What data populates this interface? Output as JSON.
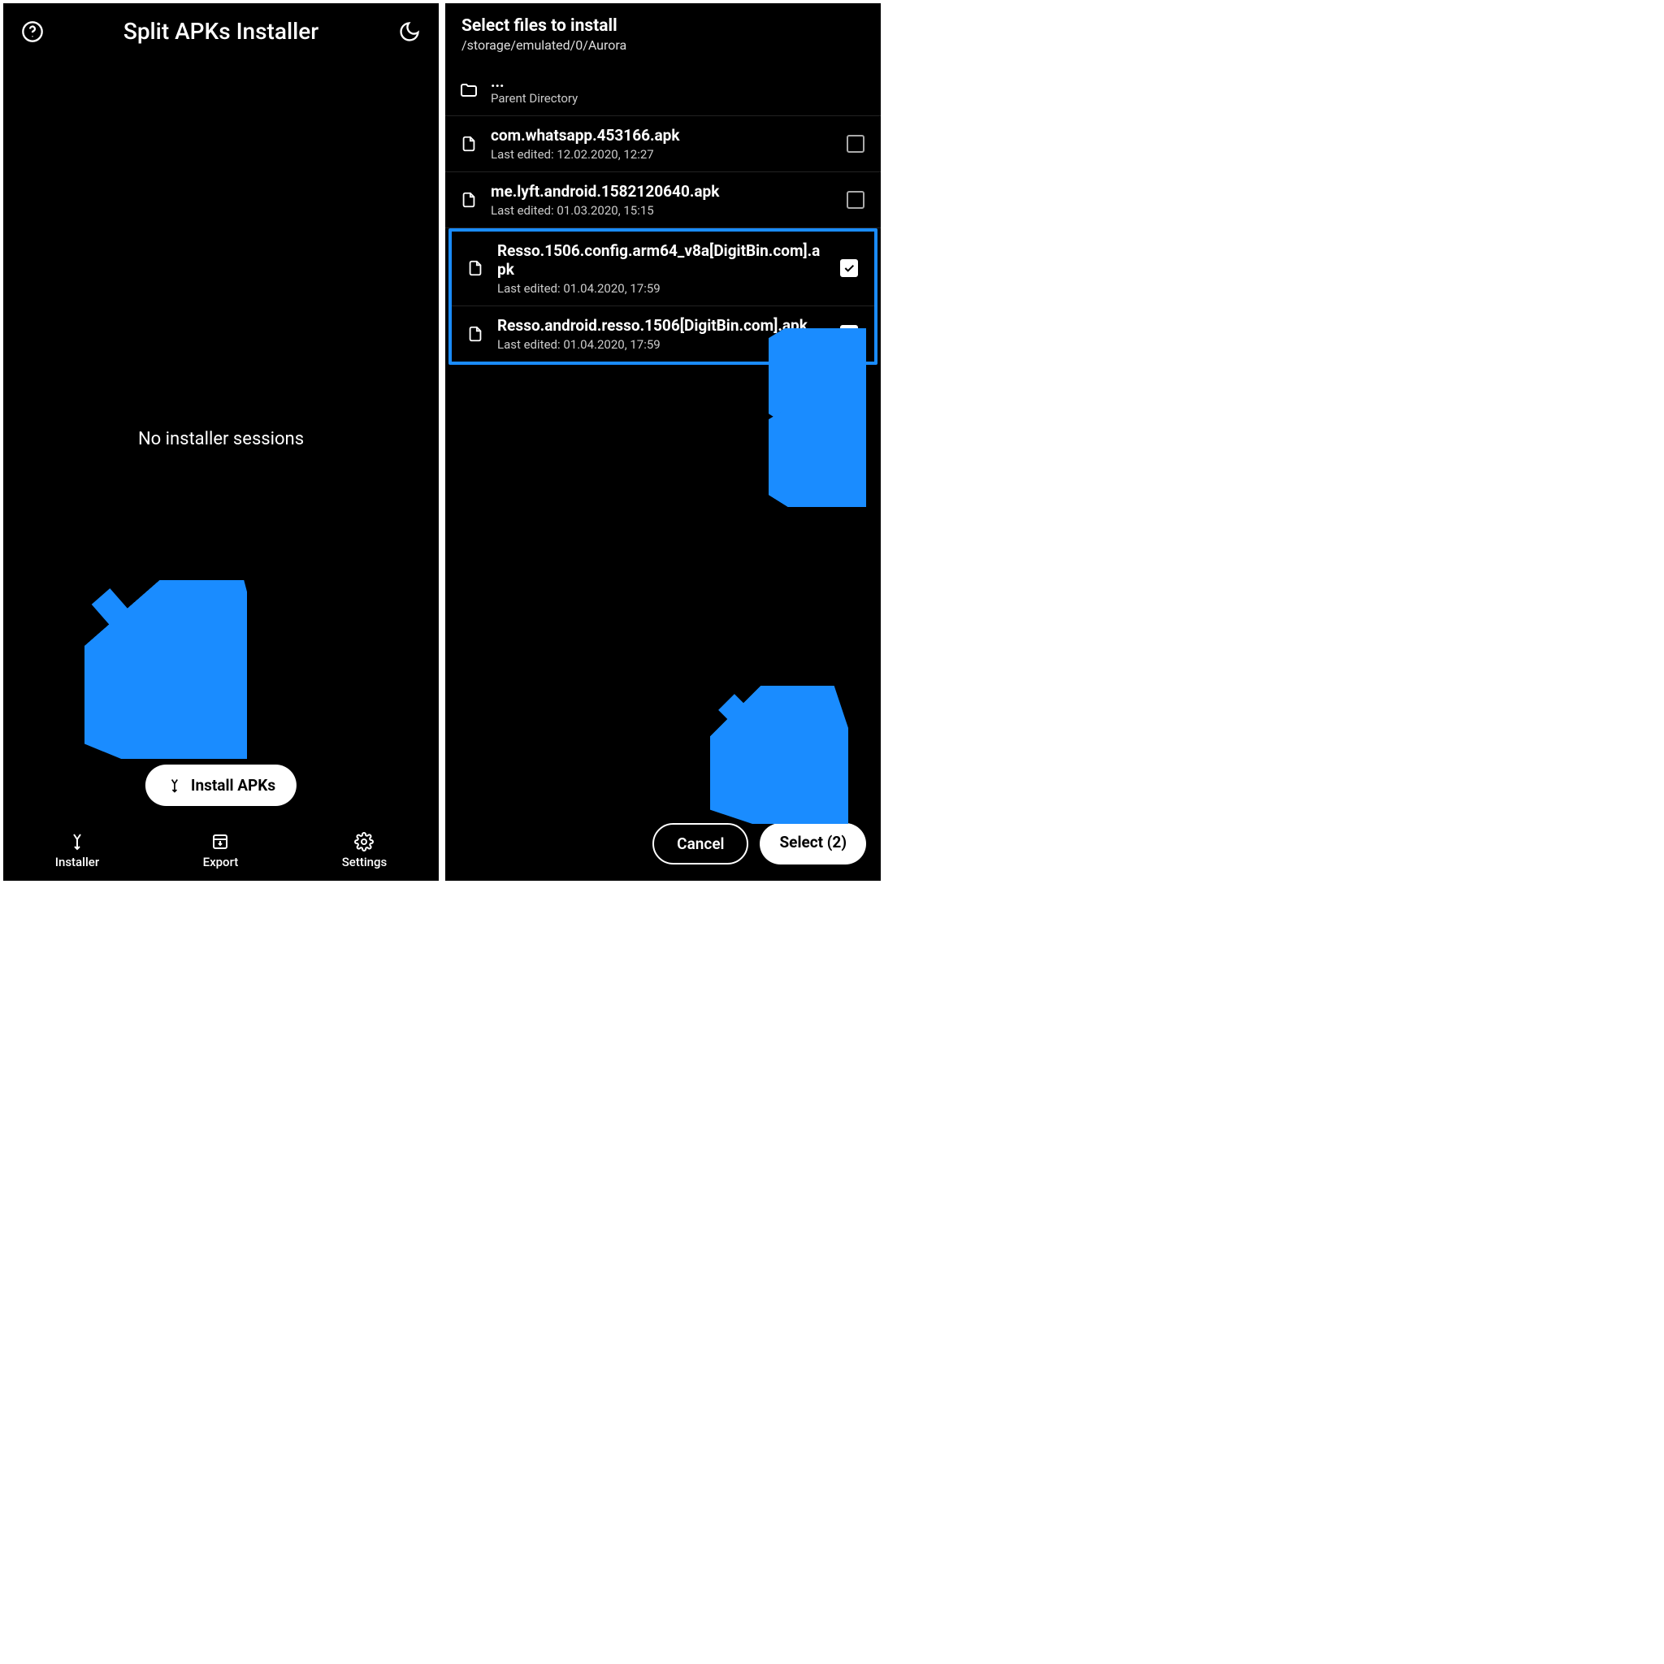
{
  "colors": {
    "accent": "#1a8cff"
  },
  "left": {
    "title": "Split APKs Installer",
    "empty_message": "No installer sessions",
    "fab_label": "Install APKs",
    "nav": [
      {
        "label": "Installer"
      },
      {
        "label": "Export"
      },
      {
        "label": "Settings"
      }
    ]
  },
  "right": {
    "header_title": "Select files to install",
    "header_path": "/storage/emulated/0/Aurora",
    "parent_dots": "...",
    "parent_label": "Parent Directory",
    "files": [
      {
        "name": "com.whatsapp.453166.apk",
        "sub": "Last edited: 12.02.2020, 12:27",
        "checked": false
      },
      {
        "name": "me.lyft.android.1582120640.apk",
        "sub": "Last edited: 01.03.2020, 15:15",
        "checked": false
      },
      {
        "name": "Resso.1506.config.arm64_v8a[DigitBin.com].apk",
        "sub": "Last edited: 01.04.2020, 17:59",
        "checked": true
      },
      {
        "name": "Resso.android.resso.1506[DigitBin.com].apk",
        "sub": "Last edited: 01.04.2020, 17:59",
        "checked": true
      }
    ],
    "cancel_label": "Cancel",
    "select_label": "Select (2)"
  }
}
